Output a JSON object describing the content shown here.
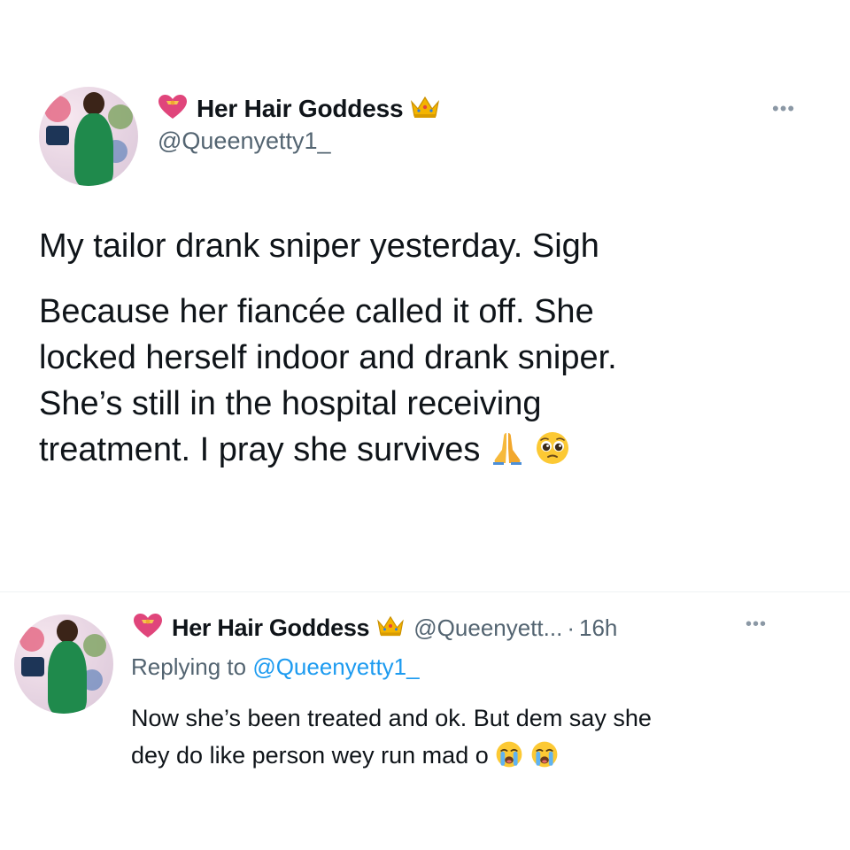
{
  "colors": {
    "text_primary": "#0f1419",
    "text_secondary": "#536471",
    "link": "#1d9bf0",
    "divider": "#eff3f4"
  },
  "tweet": {
    "author": {
      "display_name": "Her Hair Goddess",
      "handle": "@Queenyetty1_",
      "name_prefix_icon": "heart-with-ribbon-icon",
      "name_suffix_icon": "crown-icon"
    },
    "more_icon": "more-options-icon",
    "body_first_line": "My tailor drank sniper yesterday. Sigh",
    "body_lines": [
      "Because her fiancée called it off. She",
      "locked herself indoor and drank sniper.",
      "She’s still in the hospital receiving",
      "treatment. I pray she survives"
    ],
    "body_emojis": [
      "folded-hands-icon",
      "pleading-face-icon"
    ]
  },
  "reply": {
    "author": {
      "display_name": "Her Hair Goddess",
      "handle": "@Queenyett...",
      "name_prefix_icon": "heart-with-ribbon-icon",
      "name_suffix_icon": "crown-icon"
    },
    "separator": "·",
    "time": "16h",
    "more_icon": "more-options-icon",
    "replying_to_label": "Replying to",
    "replying_to_handle": "@Queenyetty1_",
    "body_lines": [
      "Now she’s been treated and ok. But dem say she",
      "dey do like person wey run mad o"
    ],
    "body_emojis": [
      "loudly-crying-face-icon",
      "loudly-crying-face-icon"
    ]
  }
}
